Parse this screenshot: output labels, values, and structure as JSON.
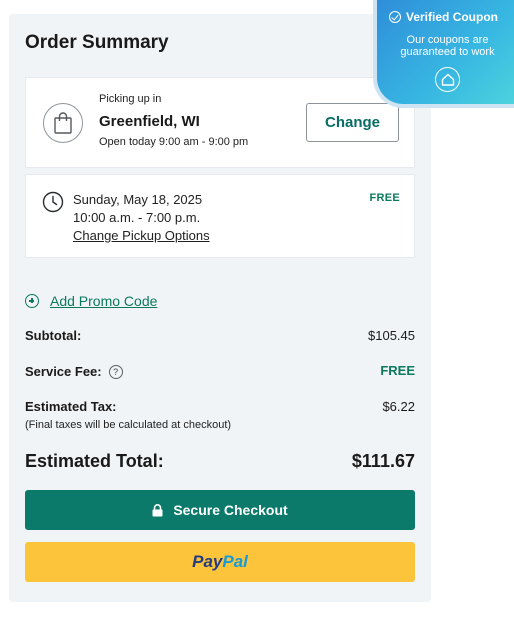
{
  "order_summary": {
    "title": "Order Summary"
  },
  "store": {
    "picking_up_label": "Picking up in",
    "city": "Greenfield, WI",
    "hours": "Open today 9:00 am - 9:00 pm",
    "change_label": "Change",
    "icon": "shopping-bag-icon"
  },
  "pickup": {
    "date": "Sunday, May 18, 2025",
    "window": "10:00 a.m. - 7:00 p.m.",
    "change_link": "Change Pickup Options",
    "fee": "FREE",
    "icon": "clock-icon"
  },
  "promo": {
    "label": "Add Promo Code",
    "icon": "plus-circle-icon"
  },
  "totals": {
    "subtotal_label": "Subtotal:",
    "subtotal_value": "$105.45",
    "service_fee_label": "Service Fee:",
    "service_fee_value": "FREE",
    "help_glyph": "?",
    "tax_label": "Estimated Tax:",
    "tax_value": "$6.22",
    "tax_note": "(Final taxes will be calculated at checkout)",
    "total_label": "Estimated Total:",
    "total_value": "$111.67"
  },
  "actions": {
    "checkout_label": "Secure Checkout",
    "paypal_part1": "Pay",
    "paypal_part2": "Pal"
  },
  "coupon_badge": {
    "title": "Verified Coupon",
    "subtitle": "Our coupons are guaranteed to work"
  },
  "colors": {
    "accent_green": "#0b7a6b",
    "paypal_yellow": "#fcc43a",
    "panel_bg": "#f1f4f7",
    "badge_blue": "#37b7e2"
  }
}
